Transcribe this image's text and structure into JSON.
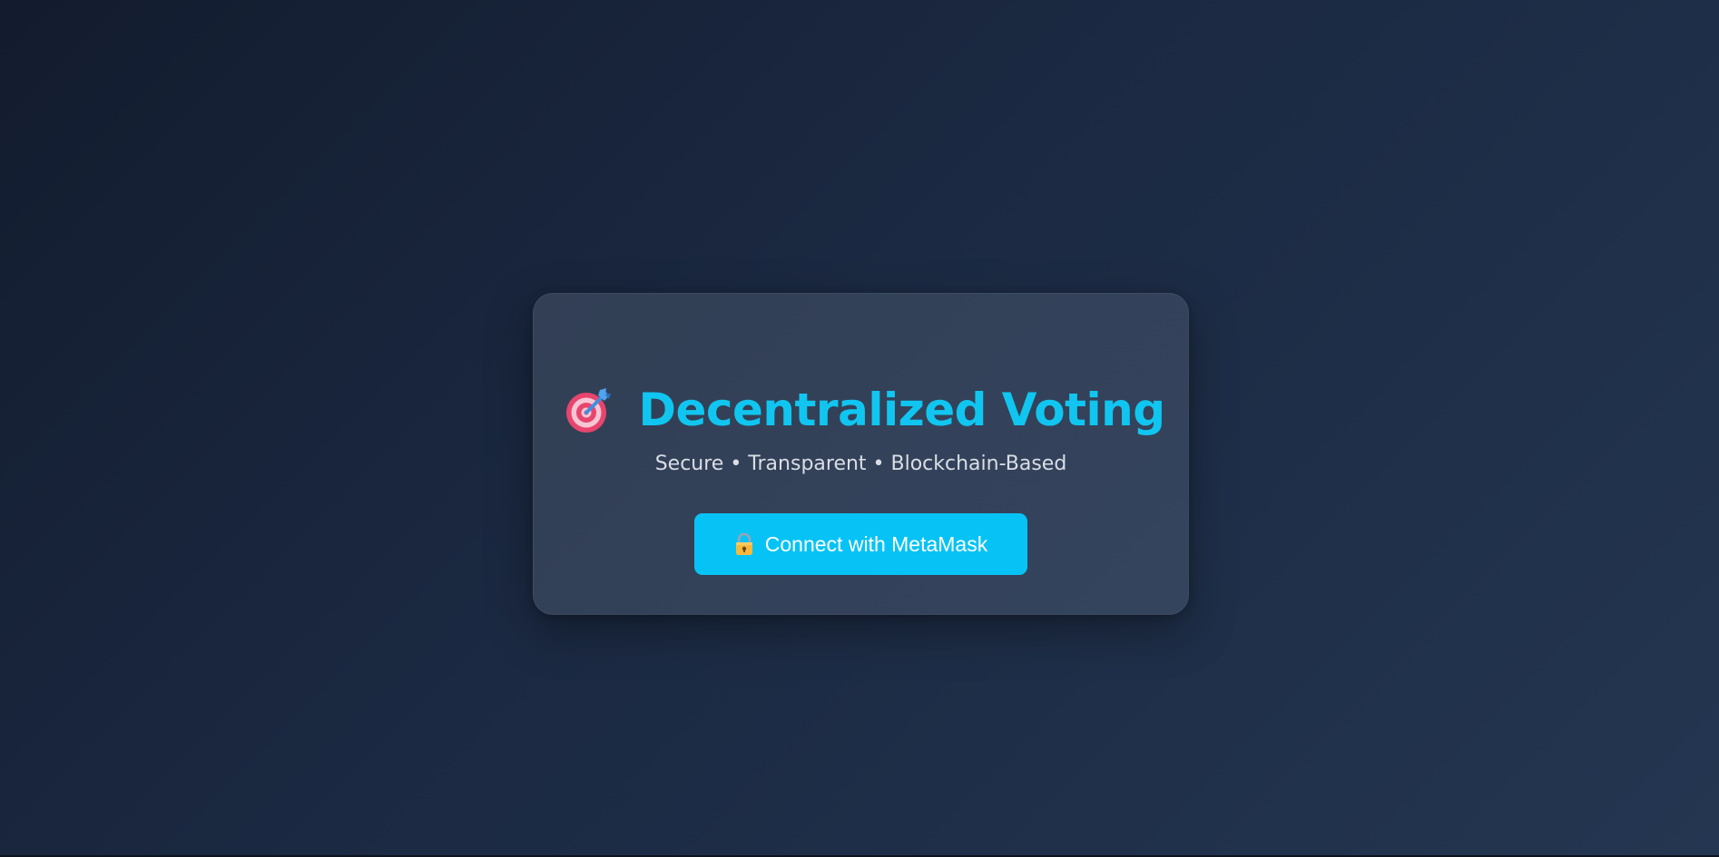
{
  "login_card": {
    "title": "Decentralized Voting",
    "title_icon": "target-dart-icon",
    "subtitle": "Secure • Transparent • Blockchain-Based",
    "connect_button": {
      "label": "Connect with MetaMask",
      "icon": "lock-icon"
    }
  },
  "colors": {
    "background_start": "#131c2e",
    "background_end": "#243651",
    "card": "#34445d",
    "accent": "#10c6f0",
    "button": "#07c3f5",
    "subtitle_text": "#d9dee6",
    "button_text": "#ffffff"
  }
}
